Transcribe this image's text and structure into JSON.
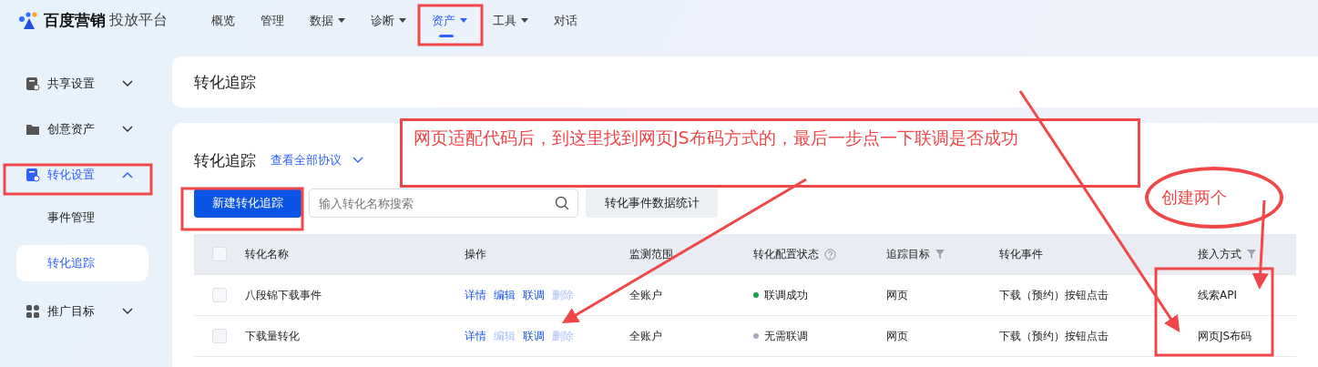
{
  "nav": {
    "brand": "百度营销",
    "product": "投放平台",
    "items": [
      {
        "label": "概览",
        "dropdown": false,
        "selected": false
      },
      {
        "label": "管理",
        "dropdown": false,
        "selected": false
      },
      {
        "label": "数据",
        "dropdown": true,
        "selected": false
      },
      {
        "label": "诊断",
        "dropdown": true,
        "selected": false
      },
      {
        "label": "资产",
        "dropdown": true,
        "selected": true
      },
      {
        "label": "工具",
        "dropdown": true,
        "selected": false
      },
      {
        "label": "对话",
        "dropdown": false,
        "selected": false
      }
    ]
  },
  "sidebar": {
    "items": [
      {
        "label": "共享设置",
        "kind": "share",
        "expanded": false,
        "selected": false
      },
      {
        "label": "创意资产",
        "kind": "folder",
        "expanded": false,
        "selected": false
      },
      {
        "label": "转化设置",
        "kind": "convert",
        "expanded": true,
        "selected": true,
        "children": [
          {
            "label": "事件管理",
            "selected": false
          },
          {
            "label": "转化追踪",
            "selected": true
          }
        ]
      },
      {
        "label": "推广目标",
        "kind": "grid",
        "expanded": false,
        "selected": false
      }
    ]
  },
  "page_title": "转化追踪",
  "card": {
    "title": "转化追踪",
    "link": "查看全部协议",
    "primary_button": "新建转化追踪",
    "search": {
      "placeholder": "输入转化名称搜索"
    },
    "secondary_button": "转化事件数据统计",
    "table": {
      "all_checked": false,
      "columns": [
        {
          "label": "转化名称",
          "help": false,
          "filter": false
        },
        {
          "label": "操作",
          "help": false,
          "filter": false
        },
        {
          "label": "监测范围",
          "help": false,
          "filter": false
        },
        {
          "label": "转化配置状态",
          "help": true,
          "filter": false
        },
        {
          "label": "追踪目标",
          "help": false,
          "filter": true
        },
        {
          "label": "转化事件",
          "help": false,
          "filter": false
        },
        {
          "label": "接入方式",
          "help": false,
          "filter": true
        }
      ],
      "rows": [
        {
          "checked": false,
          "name": "八段锦下载事件",
          "actions": [
            {
              "label": "详情",
              "disabled": false
            },
            {
              "label": "编辑",
              "disabled": false
            },
            {
              "label": "联调",
              "disabled": false
            },
            {
              "label": "删除",
              "disabled": true
            }
          ],
          "scope": "全账户",
          "status": {
            "label": "联调成功",
            "color": "#16a34a"
          },
          "target": "网页",
          "event": "下载（预约）按钮点击",
          "method": "线索API"
        },
        {
          "checked": false,
          "name": "下载量转化",
          "actions": [
            {
              "label": "详情",
              "disabled": false
            },
            {
              "label": "编辑",
              "disabled": true
            },
            {
              "label": "联调",
              "disabled": false
            },
            {
              "label": "删除",
              "disabled": true
            }
          ],
          "scope": "全账户",
          "status": {
            "label": "无需联调",
            "color": "#a3aab8"
          },
          "target": "网页",
          "event": "下载（预约）按钮点击",
          "method": "网页JS布码"
        }
      ]
    }
  },
  "annotations": {
    "callout": "网页适配代码后，到这里找到网页JS布码方式的，最后一步点一下联调是否成功",
    "ellipse_note": "创建两个"
  }
}
